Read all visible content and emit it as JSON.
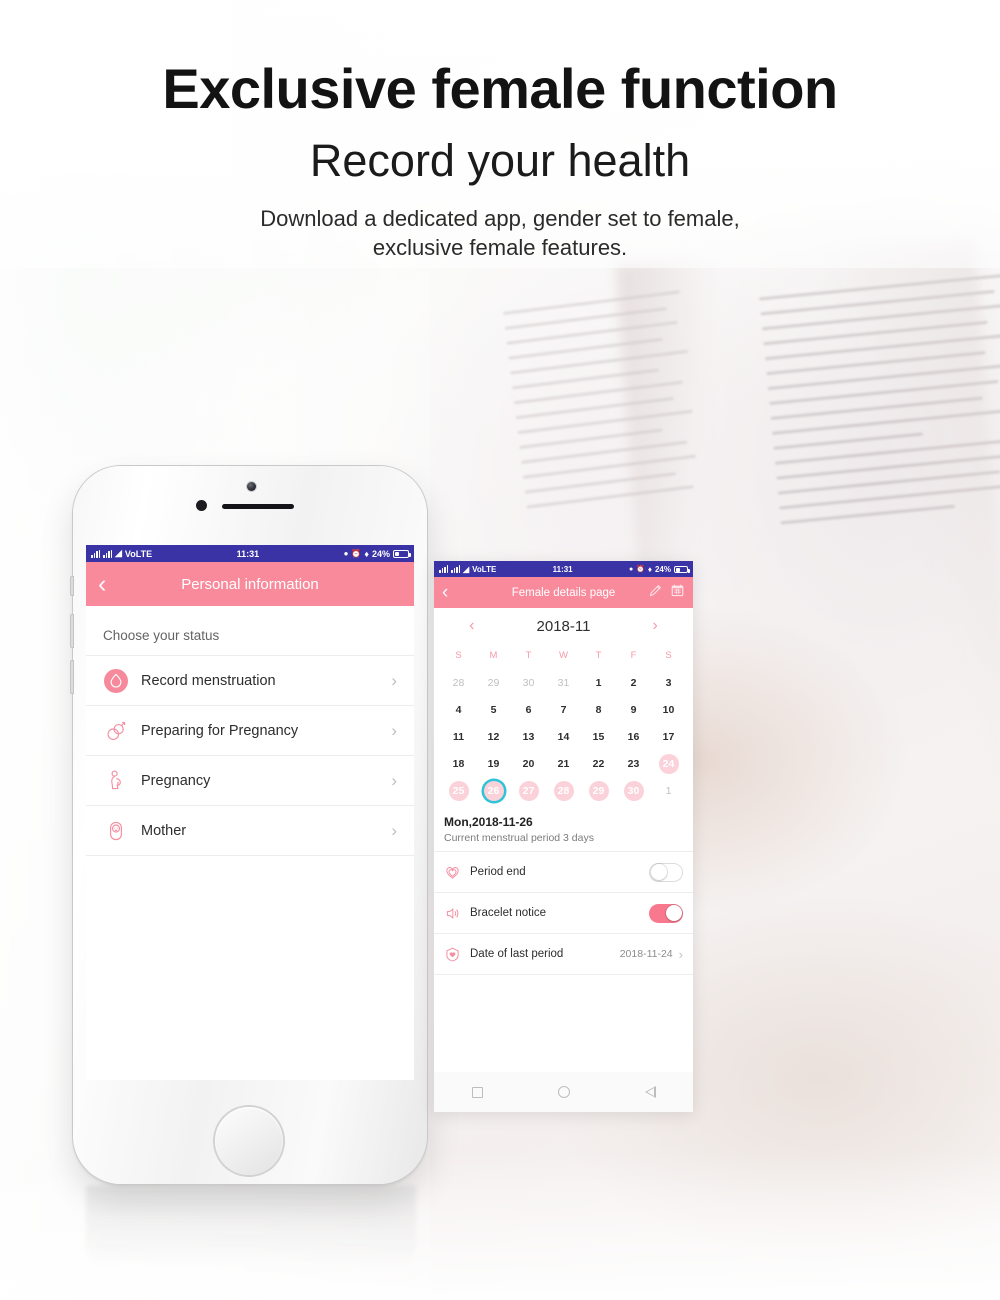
{
  "headline": {
    "title": "Exclusive female function",
    "subtitle": "Record your health",
    "description_line1": "Download a dedicated app, gender set to female,",
    "description_line2": "exclusive female features."
  },
  "colors": {
    "brand_pink": "#F98A9C",
    "light_pink": "#FBD2DA",
    "statusbar_blue": "#3A33A6",
    "today_ring_cyan": "#2EC3D6",
    "toggle_on_pink": "#F8798E"
  },
  "phone_left": {
    "statusbar": {
      "carrier": "VoLTE",
      "time": "11:31",
      "battery_percent": "24%",
      "icons": [
        "signal-icon",
        "signal-icon",
        "wifi-icon",
        "dnd-icon",
        "alarm-icon",
        "bluetooth-icon",
        "battery-icon"
      ]
    },
    "appbar": {
      "back_label": "‹",
      "title": "Personal information"
    },
    "section_label": "Choose your status",
    "rows": [
      {
        "icon": "menstruation-icon",
        "label": "Record menstruation",
        "chevron": "›",
        "icon_filled": true
      },
      {
        "icon": "preparing-pregnancy-icon",
        "label": "Preparing for Pregnancy",
        "chevron": "›",
        "icon_filled": false
      },
      {
        "icon": "pregnancy-icon",
        "label": "Pregnancy",
        "chevron": "›",
        "icon_filled": false
      },
      {
        "icon": "mother-icon",
        "label": "Mother",
        "chevron": "›",
        "icon_filled": false
      }
    ]
  },
  "phone_right": {
    "statusbar": {
      "carrier": "VoLTE",
      "time": "11:31",
      "battery_percent": "24%"
    },
    "appbar": {
      "back_label": "‹",
      "title": "Female details page",
      "actions": [
        "pen-icon",
        "calendar-icon"
      ]
    },
    "calendar": {
      "prev_label": "‹",
      "month_label": "2018-11",
      "next_label": "›",
      "weekday_headers": [
        "S",
        "M",
        "T",
        "W",
        "T",
        "F",
        "S"
      ],
      "weeks": [
        [
          {
            "n": "28",
            "state": "muted"
          },
          {
            "n": "29",
            "state": "muted"
          },
          {
            "n": "30",
            "state": "muted"
          },
          {
            "n": "31",
            "state": "muted"
          },
          {
            "n": "1",
            "state": "normal"
          },
          {
            "n": "2",
            "state": "normal"
          },
          {
            "n": "3",
            "state": "normal"
          }
        ],
        [
          {
            "n": "4",
            "state": "normal"
          },
          {
            "n": "5",
            "state": "normal"
          },
          {
            "n": "6",
            "state": "normal"
          },
          {
            "n": "7",
            "state": "normal"
          },
          {
            "n": "8",
            "state": "normal"
          },
          {
            "n": "9",
            "state": "normal"
          },
          {
            "n": "10",
            "state": "normal"
          }
        ],
        [
          {
            "n": "11",
            "state": "normal"
          },
          {
            "n": "12",
            "state": "normal"
          },
          {
            "n": "13",
            "state": "normal"
          },
          {
            "n": "14",
            "state": "normal"
          },
          {
            "n": "15",
            "state": "normal"
          },
          {
            "n": "16",
            "state": "normal"
          },
          {
            "n": "17",
            "state": "normal"
          }
        ],
        [
          {
            "n": "18",
            "state": "normal"
          },
          {
            "n": "19",
            "state": "normal"
          },
          {
            "n": "20",
            "state": "normal"
          },
          {
            "n": "21",
            "state": "normal"
          },
          {
            "n": "22",
            "state": "normal"
          },
          {
            "n": "23",
            "state": "normal"
          },
          {
            "n": "24",
            "state": "marked"
          }
        ],
        [
          {
            "n": "25",
            "state": "marked"
          },
          {
            "n": "26",
            "state": "today"
          },
          {
            "n": "27",
            "state": "marked"
          },
          {
            "n": "28",
            "state": "marked"
          },
          {
            "n": "29",
            "state": "marked"
          },
          {
            "n": "30",
            "state": "marked"
          },
          {
            "n": "1",
            "state": "muted"
          }
        ]
      ]
    },
    "selected_date": "Mon,2018-11-26",
    "selected_note": "Current menstrual period 3 days",
    "detail_rows": [
      {
        "icon": "heart-outline-icon",
        "label": "Period end",
        "control": "toggle",
        "toggle_state": "off"
      },
      {
        "icon": "speaker-icon",
        "label": "Bracelet notice",
        "control": "toggle",
        "toggle_state": "on"
      },
      {
        "icon": "heart-shield-icon",
        "label": "Date of last period",
        "control": "value",
        "value": "2018-11-24",
        "chevron": "›"
      }
    ],
    "navbar": [
      "recents-square-icon",
      "home-circle-icon",
      "back-triangle-icon"
    ]
  }
}
